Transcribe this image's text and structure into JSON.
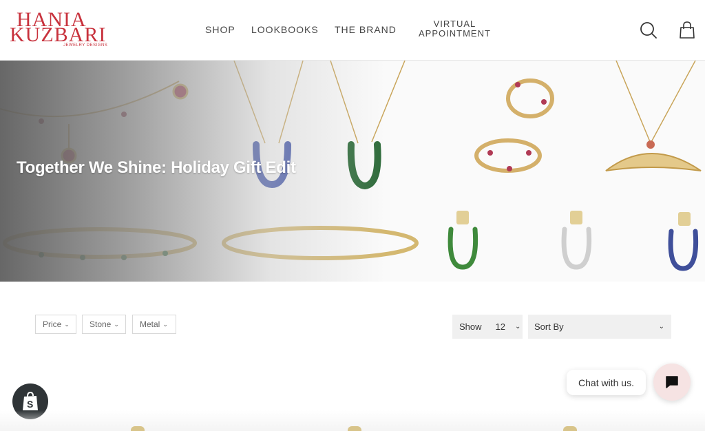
{
  "brand": {
    "line1": "HANIA",
    "line2": "KUZBARI",
    "tagline": "JEWELRY DESIGNS",
    "color": "#c8323d"
  },
  "nav": {
    "items": [
      {
        "label": "SHOP"
      },
      {
        "label": "LOOKBOOKS"
      },
      {
        "label": "THE BRAND"
      },
      {
        "label_line1": "VIRTUAL",
        "label_line2": "APPOINTMENT"
      }
    ],
    "icons": [
      "search-icon",
      "shopping-bag-icon"
    ]
  },
  "hero": {
    "title": "Together We Shine: Holiday Gift Edit",
    "image_subjects": [
      "necklaces",
      "horseshoe pendants",
      "hoop earrings",
      "bangles",
      "horseshoe charms"
    ]
  },
  "filters": [
    {
      "label": "Price"
    },
    {
      "label": "Stone"
    },
    {
      "label": "Metal"
    }
  ],
  "show": {
    "label": "Show",
    "value": "12"
  },
  "sort": {
    "label": "Sort By"
  },
  "chat": {
    "bubble_text": "Chat with us.",
    "icon": "chat-icon",
    "button_color": "#f6e3e3"
  },
  "shopify_badge": {
    "icon": "shopify-bag-icon",
    "color": "#2f3437"
  }
}
